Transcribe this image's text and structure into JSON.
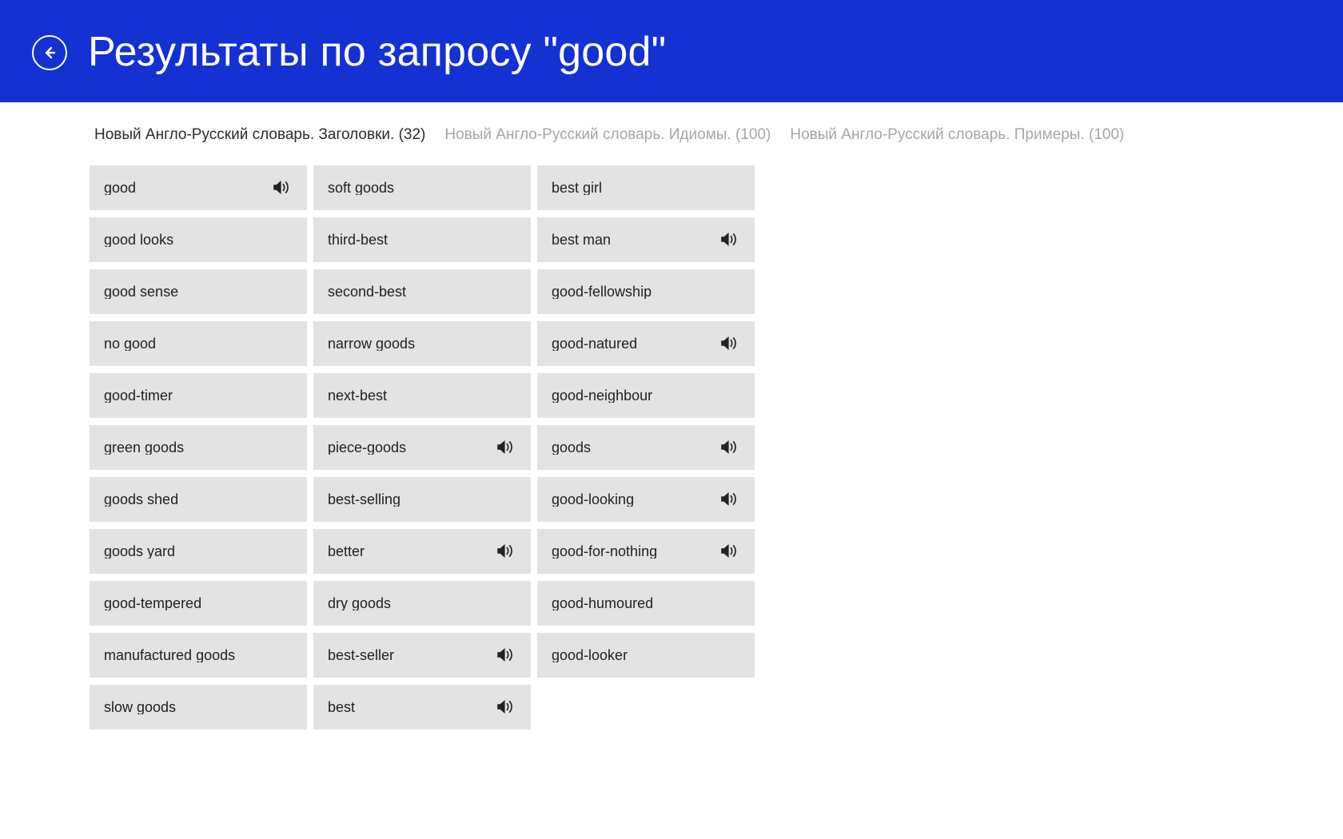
{
  "header": {
    "back_icon": "back-arrow-circle-icon",
    "title": "Результаты по запросу  \"good\"",
    "background_color": "#1431d4",
    "text_color": "#ffffff"
  },
  "tabs": [
    {
      "label": "Новый Англо-Русский словарь. Заголовки. (32)",
      "active": true,
      "count": 32
    },
    {
      "label": "Новый Англо-Русский словарь. Идиомы. (100)",
      "active": false,
      "count": 100
    },
    {
      "label": "Новый Англо-Русский словарь. Примеры. (100)",
      "active": false,
      "count": 100
    }
  ],
  "results": {
    "tile_background": "#e3e3e3",
    "tile_text_color": "#212121",
    "speaker_icon_name": "speaker-audio-icon",
    "columns": [
      {
        "items": [
          {
            "label": "good",
            "has_audio": true
          },
          {
            "label": "good looks",
            "has_audio": false
          },
          {
            "label": "good sense",
            "has_audio": false
          },
          {
            "label": "no good",
            "has_audio": false
          },
          {
            "label": "good-timer",
            "has_audio": false
          },
          {
            "label": "green goods",
            "has_audio": false
          },
          {
            "label": "goods shed",
            "has_audio": false
          },
          {
            "label": "goods yard",
            "has_audio": false
          },
          {
            "label": "good-tempered",
            "has_audio": false
          },
          {
            "label": "manufactured goods",
            "has_audio": false
          },
          {
            "label": "slow goods",
            "has_audio": false
          }
        ]
      },
      {
        "items": [
          {
            "label": "soft goods",
            "has_audio": false
          },
          {
            "label": "third-best",
            "has_audio": false
          },
          {
            "label": "second-best",
            "has_audio": false
          },
          {
            "label": "narrow goods",
            "has_audio": false
          },
          {
            "label": "next-best",
            "has_audio": false
          },
          {
            "label": "piece-goods",
            "has_audio": true
          },
          {
            "label": "best-selling",
            "has_audio": false
          },
          {
            "label": "better",
            "has_audio": true
          },
          {
            "label": "dry goods",
            "has_audio": false
          },
          {
            "label": "best-seller",
            "has_audio": true
          },
          {
            "label": "best",
            "has_audio": true
          }
        ]
      },
      {
        "items": [
          {
            "label": "best girl",
            "has_audio": false
          },
          {
            "label": "best man",
            "has_audio": true
          },
          {
            "label": "good-fellowship",
            "has_audio": false
          },
          {
            "label": "good-natured",
            "has_audio": true
          },
          {
            "label": "good-neighbour",
            "has_audio": false
          },
          {
            "label": "goods",
            "has_audio": true
          },
          {
            "label": "good-looking",
            "has_audio": true
          },
          {
            "label": "good-for-nothing",
            "has_audio": true
          },
          {
            "label": "good-humoured",
            "has_audio": false
          },
          {
            "label": "good-looker",
            "has_audio": false
          }
        ]
      }
    ]
  }
}
